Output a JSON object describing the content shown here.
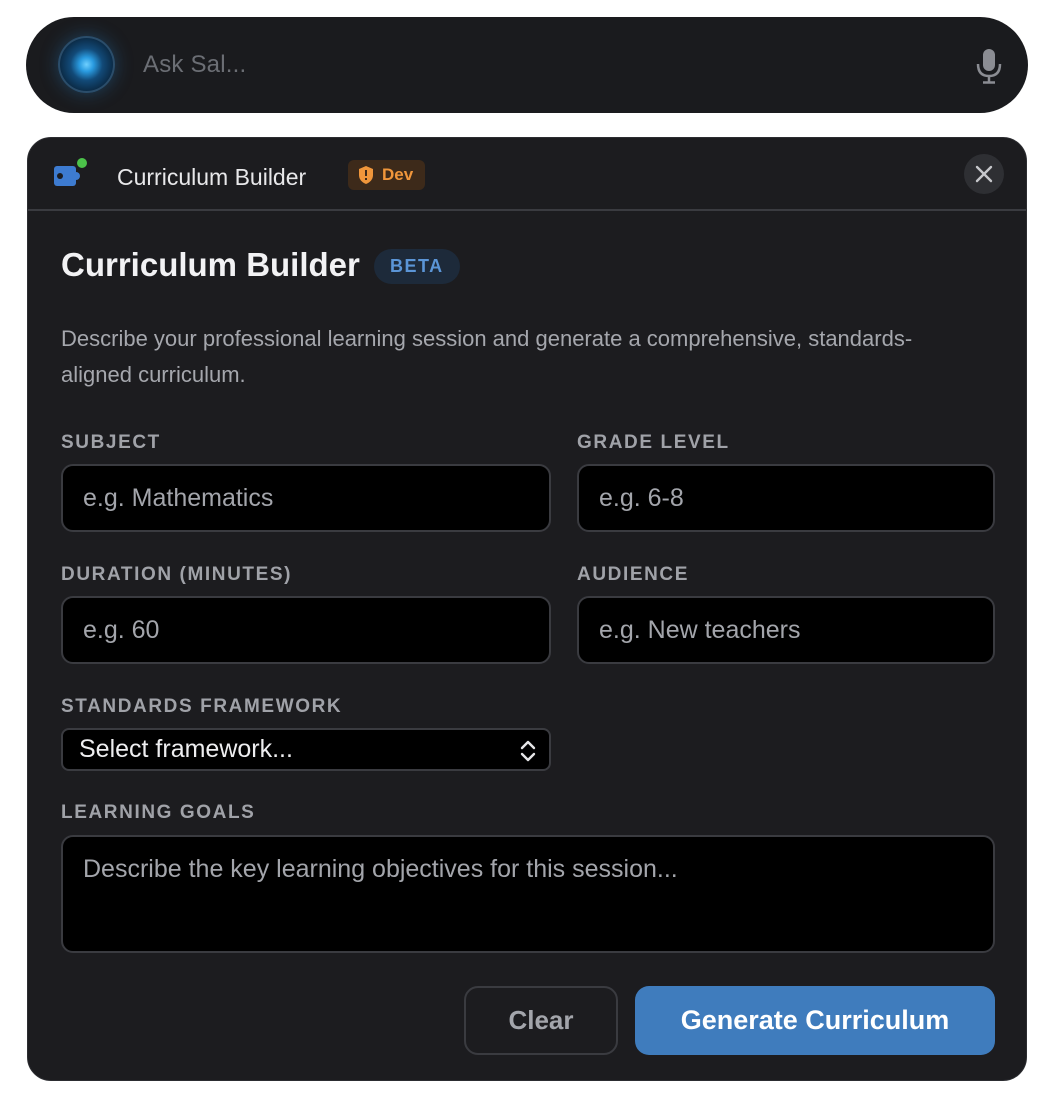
{
  "ask_bar": {
    "placeholder": "Ask Sal..."
  },
  "titlebar": {
    "title": "Curriculum Builder",
    "badge": "Dev"
  },
  "main": {
    "heading": "Curriculum Builder",
    "badge": "BETA",
    "description": "Describe your professional learning session and generate a comprehensive, standards-aligned curriculum."
  },
  "form": {
    "subject": {
      "label": "SUBJECT",
      "placeholder": "e.g. Mathematics"
    },
    "grade_level": {
      "label": "GRADE LEVEL",
      "placeholder": "e.g. 6-8"
    },
    "duration": {
      "label": "DURATION (MINUTES)",
      "placeholder": "e.g. 60"
    },
    "audience": {
      "label": "AUDIENCE",
      "placeholder": "e.g. New teachers"
    },
    "framework": {
      "label": "STANDARDS FRAMEWORK",
      "selected": "Select framework..."
    },
    "goals": {
      "label": "LEARNING GOALS",
      "placeholder": "Describe the key learning objectives for this session..."
    }
  },
  "actions": {
    "clear": "Clear",
    "generate": "Generate Curriculum"
  },
  "icons": {
    "assistant": "sal-orb-icon",
    "mic": "microphone-icon",
    "app": "puzzle-piece-icon",
    "badge": "shield-icon",
    "close": "close-icon",
    "select": "chevron-up-down-icon"
  },
  "colors": {
    "accent": "#3f7cbd",
    "dev_badge": "#f0963b",
    "beta_badge": "#5b95d6",
    "panel_bg": "#1c1c1f"
  }
}
